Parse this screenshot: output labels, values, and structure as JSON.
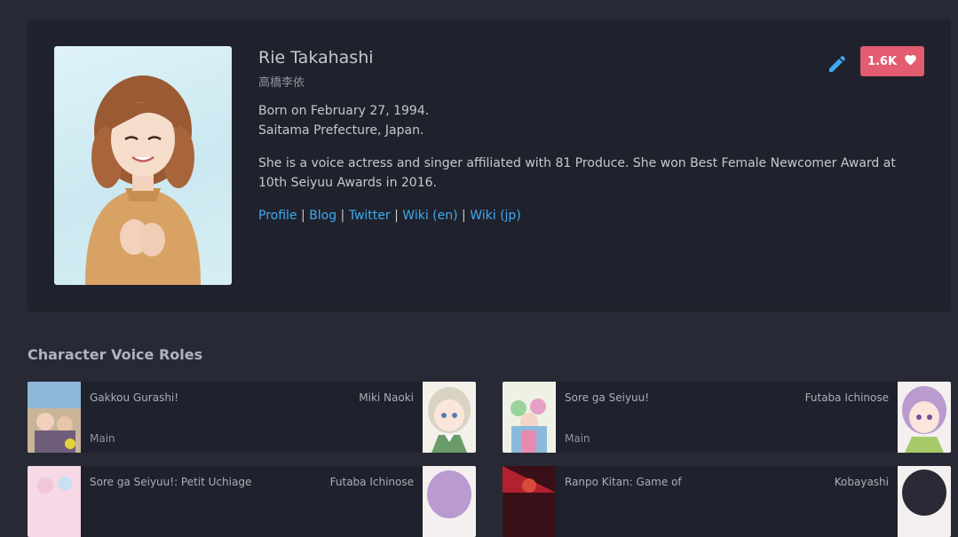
{
  "profile": {
    "name": "Rie Takahashi",
    "native_name": "高橋李依",
    "birth_line": "Born on February 27, 1994.",
    "location_line": "Saitama Prefecture, Japan.",
    "bio": "She is a voice actress and singer affiliated with 81 Produce. She won Best Female Newcomer Award at 10th Seiyuu Awards in 2016.",
    "links": [
      "Profile",
      "Blog",
      "Twitter",
      "Wiki (en)",
      "Wiki (jp)"
    ],
    "link_separator": " | ",
    "favourites": "1.6K",
    "edit_icon": "pencil-icon",
    "fav_icon": "heart-icon"
  },
  "roles_section": {
    "title": "Character Voice Roles",
    "roles": [
      {
        "media": "Gakkou Gurashi!",
        "character": "Miki Naoki",
        "role": "Main"
      },
      {
        "media": "Sore ga Seiyuu!",
        "character": "Futaba Ichinose",
        "role": "Main"
      },
      {
        "media": "Sore ga Seiyuu!: Petit Uchiage",
        "character": "Futaba Ichinose",
        "role": ""
      },
      {
        "media": "Ranpo Kitan: Game of",
        "character": "Kobayashi",
        "role": ""
      }
    ]
  },
  "colors": {
    "background": "#272a35",
    "card": "#1f222c",
    "link": "#3ea9f2",
    "favourite": "#e35c70"
  }
}
